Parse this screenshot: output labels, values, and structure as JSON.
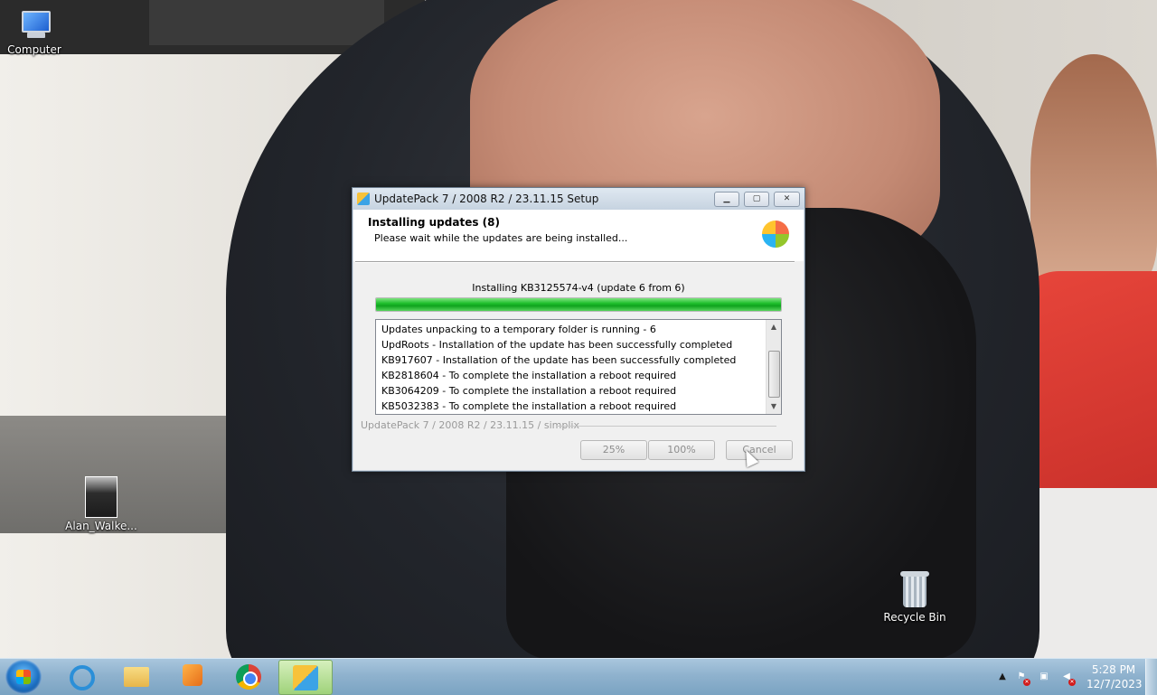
{
  "desktop": {
    "icons": [
      {
        "label": "Computer"
      },
      {
        "label": "Alan_Walke..."
      },
      {
        "label": "Recycle Bin"
      }
    ]
  },
  "setup": {
    "window_title": "UpdatePack 7 / 2008 R2 / 23.11.15 Setup",
    "header_title": "Installing updates (8)",
    "header_subtitle": "Please wait while the updates are being installed...",
    "progress_label": "Installing KB3125574-v4 (update 6 from 6)",
    "progress_fraction": 1.0,
    "log": [
      "Updates unpacking to a temporary folder is running - 6",
      "UpdRoots - Installation of the update has been successfully completed",
      "KB917607 - Installation of the update has been successfully completed",
      "KB2818604 - To complete the installation a reboot required",
      "KB3064209 - To complete the installation a reboot required",
      "KB5032383 - To complete the installation a reboot required"
    ],
    "brand": "UpdatePack 7 / 2008 R2 / 23.11.15 / simplix",
    "buttons": {
      "pct25": "25%",
      "pct100": "100%",
      "cancel": "Cancel"
    }
  },
  "taskbar": {
    "apps": [
      {
        "icon": "internet-explorer-icon"
      },
      {
        "icon": "windows-explorer-icon"
      },
      {
        "icon": "media-player-icon"
      },
      {
        "icon": "chrome-icon"
      },
      {
        "icon": "updatepack-setup-icon",
        "active": true
      }
    ],
    "clock_time": "5:28 PM",
    "clock_date": "12/7/2023"
  },
  "colors": {
    "progress_green": "#1fbf2d",
    "taskbar": "#8fb2ce"
  }
}
